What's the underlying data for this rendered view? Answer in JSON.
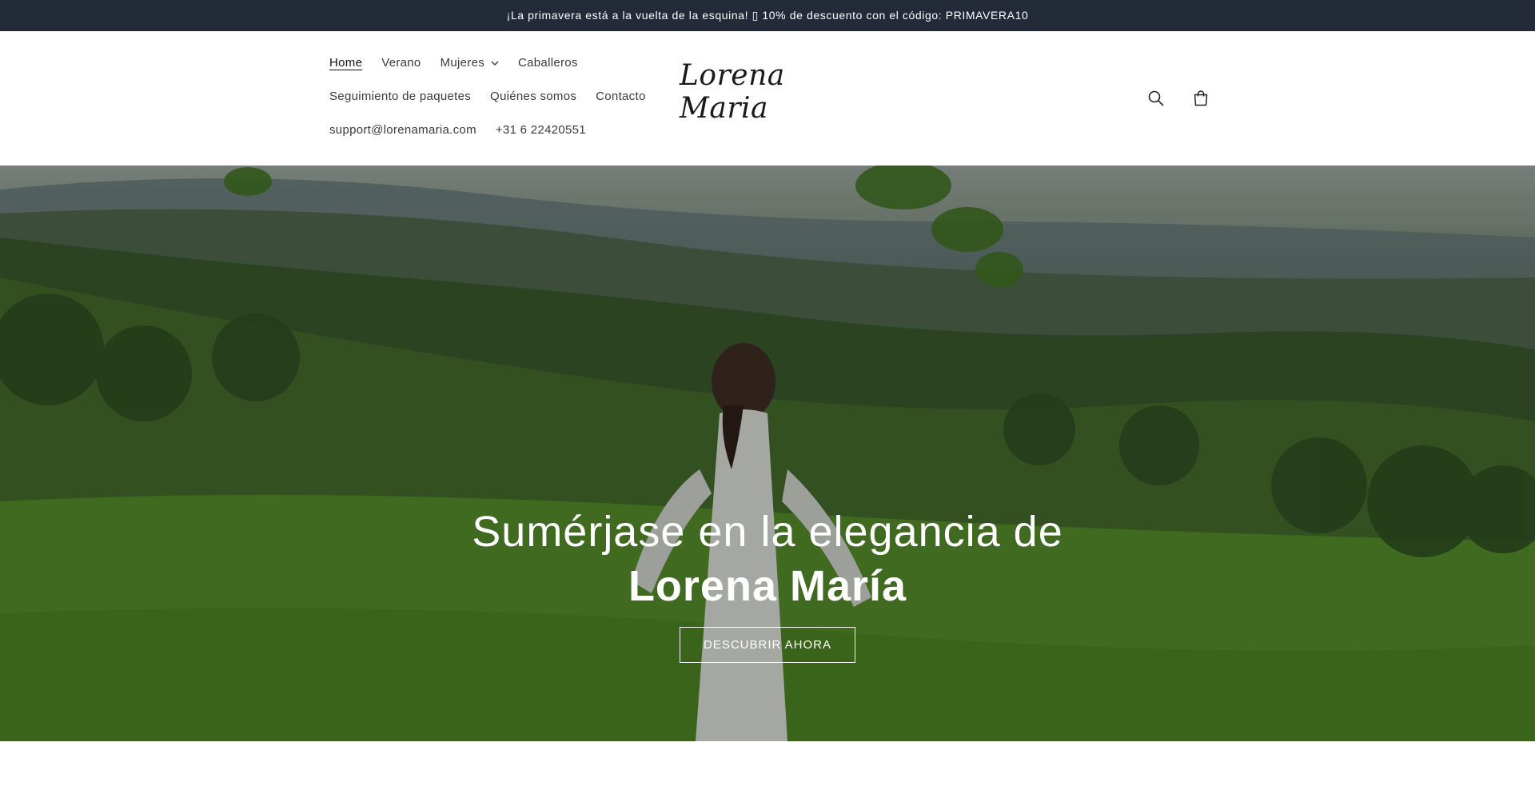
{
  "announcement": "¡La primavera está a la vuelta de la esquina! ▯ 10% de descuento con el código: PRIMAVERA10",
  "nav": {
    "items": [
      {
        "label": "Home"
      },
      {
        "label": "Verano"
      },
      {
        "label": "Mujeres"
      },
      {
        "label": "Caballeros"
      },
      {
        "label": "Seguimiento de paquetes"
      },
      {
        "label": "Quiénes somos"
      },
      {
        "label": "Contacto"
      },
      {
        "label": "support@lorenamaria.com"
      },
      {
        "label": "+31 6 22420551"
      }
    ]
  },
  "logo": "Lorena Maria",
  "icons": {
    "search": "search-icon",
    "cart": "cart-icon",
    "dropdown": "chevron-down-icon"
  },
  "hero": {
    "line1": "Sumérjase en la elegancia de",
    "line2": "Lorena María",
    "cta": "DESCUBRIR AHORA"
  },
  "colors": {
    "announcement_bg": "#232a38",
    "header_bg": "#ffffff"
  }
}
